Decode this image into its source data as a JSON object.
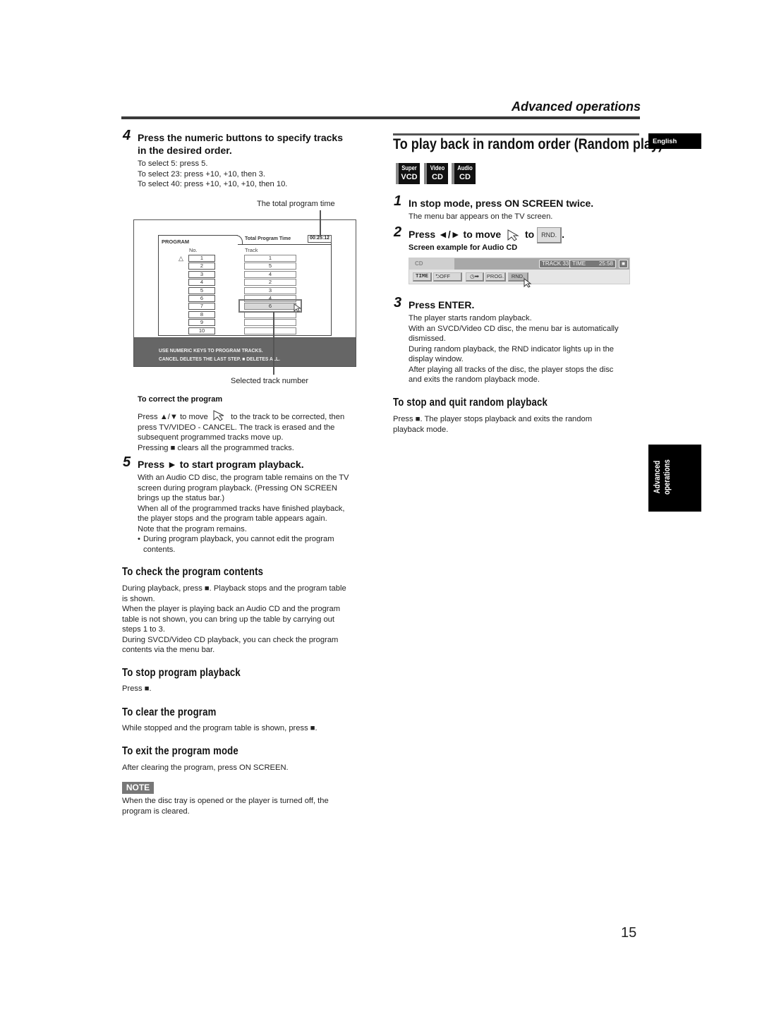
{
  "header": {
    "section_title": "Advanced operations"
  },
  "left": {
    "step4": {
      "num": "4",
      "head_line1": "Press the numeric buttons to specify tracks",
      "head_line2": "in the desired order.",
      "lines": [
        "To select 5: press 5.",
        "To select 23: press +10, +10, then 3.",
        "To select 40: press +10, +10, +10, then 10."
      ]
    },
    "program_screen": {
      "callout_top": "The total program time",
      "callout_bottom": "Selected track number",
      "tab_label": "PROGRAM",
      "time_label": "Total Program Time",
      "time_value": "00:25:12",
      "col_no": "No.",
      "col_track": "Track",
      "rows": [
        {
          "no": "1",
          "track": "1"
        },
        {
          "no": "2",
          "track": "5"
        },
        {
          "no": "3",
          "track": "4"
        },
        {
          "no": "4",
          "track": "2"
        },
        {
          "no": "5",
          "track": "3"
        },
        {
          "no": "6",
          "track": "4"
        },
        {
          "no": "7",
          "track": "6"
        },
        {
          "no": "8",
          "track": ""
        },
        {
          "no": "9",
          "track": ""
        },
        {
          "no": "10",
          "track": ""
        }
      ],
      "selected_row": 7,
      "msg_line1": "USE NUMERIC KEYS  TO PROGRAM TRACKS.",
      "msg_line2": "CANCEL DELETES THE LAST STEP. ■ DELETES ALL."
    },
    "correct": {
      "head": "To correct the program",
      "l1a": "Press ▲/▼ to move",
      "l1b": "to the track to be corrected, then",
      "l2": "press TV/VIDEO - CANCEL. The track is erased and the",
      "l3": "subsequent programmed tracks move up.",
      "l4": "Pressing ■ clears all the programmed tracks."
    },
    "step5": {
      "num": "5",
      "head": "Press ► to start program playback.",
      "lines": [
        "With an Audio CD disc, the program table remains on the TV",
        "screen during program playback. (Pressing ON SCREEN",
        "brings up the status bar.)",
        "When all of the programmed tracks have finished playback,",
        "the player stops and the program table appears again.",
        "Note that the program remains."
      ],
      "bullet_l1": "During program playback, you cannot edit the program",
      "bullet_l2": "contents."
    },
    "check": {
      "head": "To check the program contents",
      "lines": [
        "During playback, press ■. Playback stops and the program table",
        "is shown.",
        "When the player is playing back an Audio CD and the program",
        "table is not shown, you can bring up the table by carrying out",
        "steps 1 to 3.",
        "During SVCD/Video CD playback, you can check the program",
        "contents via the menu bar."
      ]
    },
    "stop": {
      "head": "To stop program playback",
      "text": "Press ■."
    },
    "clear": {
      "head": "To clear the program",
      "text": "While stopped and the program table is shown, press ■."
    },
    "exit": {
      "head": "To exit the program mode",
      "text": "After clearing the program, press ON SCREEN."
    },
    "note": {
      "badge": "NOTE",
      "l1": "When the disc tray is opened or the player is turned off, the",
      "l2": "program is cleared."
    }
  },
  "right": {
    "title": "To play back in random order (Random play)",
    "lang_tab": "English",
    "discs": [
      {
        "a": "Super",
        "b": "VCD"
      },
      {
        "a": "Video",
        "b": "CD"
      },
      {
        "a": "Audio",
        "b": "CD"
      }
    ],
    "step1": {
      "num": "1",
      "head": "In stop mode, press ON SCREEN twice.",
      "text": "The menu bar appears on the TV screen."
    },
    "step2": {
      "num": "2",
      "head_a": "Press ◄/► to move",
      "head_b": "to",
      "chip": "RND.",
      "head_end": ".",
      "sub": "Screen example for Audio CD"
    },
    "menubar": {
      "disc": "CD",
      "track": "TRACK 33",
      "time_label": "TIME",
      "time_value": "25:58",
      "stop_icon": "■",
      "buttons": [
        "TIME",
        "OFF",
        "PROG.",
        "RND."
      ]
    },
    "step3": {
      "num": "3",
      "head": "Press ENTER.",
      "lines": [
        "The player starts random playback.",
        "With an SVCD/Video CD disc, the menu bar is automatically",
        "dismissed.",
        "During random playback, the RND indicator lights up in the",
        "display window.",
        "After playing all tracks of the disc, the player stops the disc",
        "and exits the random playback mode."
      ]
    },
    "quit": {
      "head": "To stop and quit random playback",
      "l1": "Press ■. The player stops playback and exits the random",
      "l2": "playback mode."
    },
    "side_tab_l1": "Advanced",
    "side_tab_l2": "operations"
  },
  "page_number": "15"
}
